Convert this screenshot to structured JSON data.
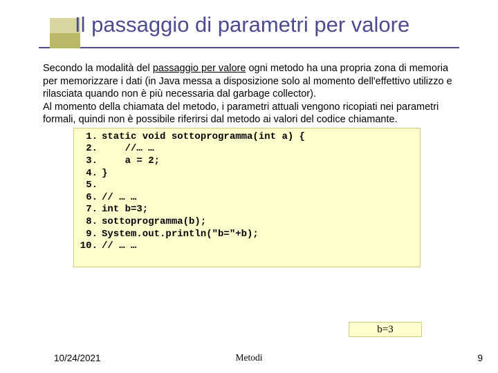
{
  "title": "Il passaggio di parametri per valore",
  "para_before": "Secondo la modalità del ",
  "para_underlined": "passaggio per valore",
  "para_after": " ogni metodo ha una propria zona di memoria per memorizzare i dati (in Java messa a disposizione solo al momento dell'effettivo utilizzo e rilasciata quando non è più necessaria dal garbage collector).",
  "para2": "Al momento della chiamata del metodo, i parametri attuali vengono ricopiati nei parametri formali, quindi non è possibile riferirsi dal metodo ai valori del codice chiamante.",
  "code": [
    {
      "n": "1.",
      "t": "static void sottoprogramma(int a) {"
    },
    {
      "n": "2.",
      "t": "    //… …"
    },
    {
      "n": "3.",
      "t": "    a = 2;"
    },
    {
      "n": "4.",
      "t": "}"
    },
    {
      "n": "5.",
      "t": ""
    },
    {
      "n": "6.",
      "t": "// … …"
    },
    {
      "n": "7.",
      "t": "int b=3;"
    },
    {
      "n": "8.",
      "t": "sottoprogramma(b);"
    },
    {
      "n": "9.",
      "t": "System.out.println(\"b=\"+b);"
    },
    {
      "n": "10.",
      "t": "// … …"
    }
  ],
  "output": "b=3",
  "footer": {
    "date": "10/24/2021",
    "center": "Metodi",
    "page": "9"
  }
}
